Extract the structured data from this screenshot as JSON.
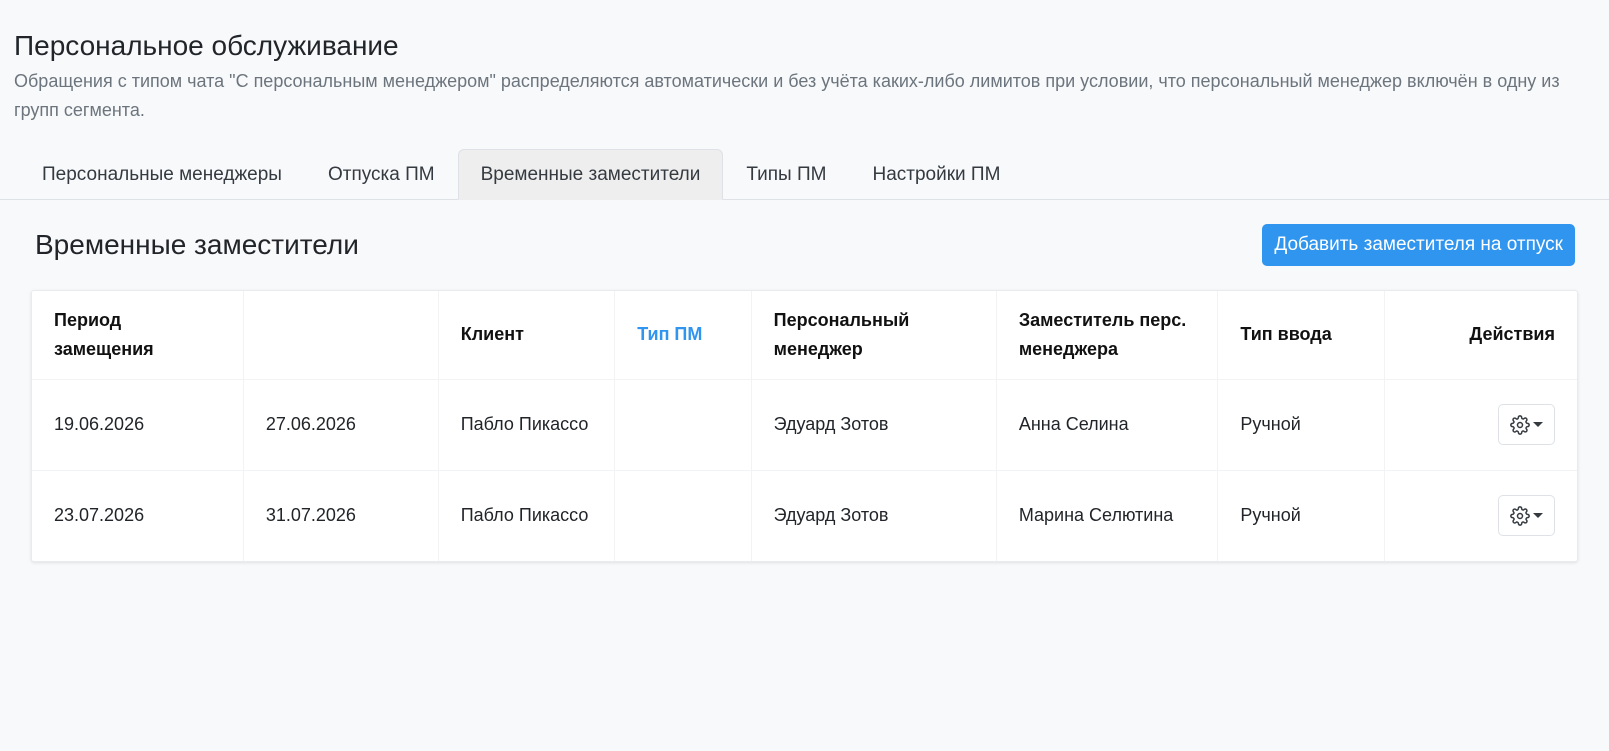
{
  "header": {
    "title": "Персональное обслуживание",
    "description": "Обращения с типом чата \"С персональным менеджером\" распределяются автоматически и без учёта каких-либо лимитов при условии, что персональный менеджер включён в одну из групп сегмента."
  },
  "tabs": [
    {
      "label": "Персональные менеджеры",
      "active": false
    },
    {
      "label": "Отпуска ПМ",
      "active": false
    },
    {
      "label": "Временные заместители",
      "active": true
    },
    {
      "label": "Типы ПМ",
      "active": false
    },
    {
      "label": "Настройки ПМ",
      "active": false
    }
  ],
  "section": {
    "title": "Временные заместители",
    "add_button": "Добавить заместителя на отпуск"
  },
  "table": {
    "columns": {
      "period": "Период замещения",
      "period_end": "",
      "client": "Клиент",
      "pm_type": "Тип ПМ",
      "manager": "Персональный менеджер",
      "deputy": "Заместитель перс. менеджера",
      "input_type": "Тип ввода",
      "actions": "Действия"
    },
    "rows": [
      {
        "start": "19.06.2026",
        "end": "27.06.2026",
        "client": "Пабло Пикассо",
        "pm_type": "",
        "manager": "Эдуард Зотов",
        "deputy": "Анна Селина",
        "input_type": "Ручной"
      },
      {
        "start": "23.07.2026",
        "end": "31.07.2026",
        "client": "Пабло Пикассо",
        "pm_type": "",
        "manager": "Эдуард Зотов",
        "deputy": "Марина Селютина",
        "input_type": "Ручной"
      }
    ]
  },
  "colors": {
    "accent": "#2f95ef",
    "muted_text": "#6c757d",
    "active_tab_bg": "#eeeeee",
    "page_bg": "#f8f9fb"
  },
  "icons": {
    "row_actions": "gear-icon",
    "dropdown": "caret-down-icon"
  }
}
